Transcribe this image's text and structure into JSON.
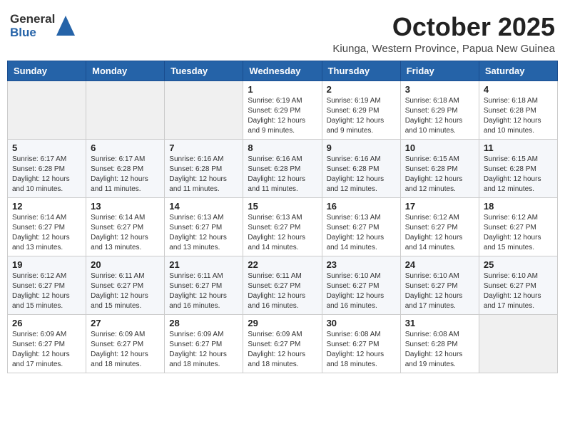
{
  "logo": {
    "general": "General",
    "blue": "Blue"
  },
  "header": {
    "month_title": "October 2025",
    "subtitle": "Kiunga, Western Province, Papua New Guinea"
  },
  "days_of_week": [
    "Sunday",
    "Monday",
    "Tuesday",
    "Wednesday",
    "Thursday",
    "Friday",
    "Saturday"
  ],
  "weeks": [
    [
      {
        "day": "",
        "sunrise": "",
        "sunset": "",
        "daylight": "",
        "empty": true
      },
      {
        "day": "",
        "sunrise": "",
        "sunset": "",
        "daylight": "",
        "empty": true
      },
      {
        "day": "",
        "sunrise": "",
        "sunset": "",
        "daylight": "",
        "empty": true
      },
      {
        "day": "1",
        "sunrise": "Sunrise: 6:19 AM",
        "sunset": "Sunset: 6:29 PM",
        "daylight": "Daylight: 12 hours and 9 minutes."
      },
      {
        "day": "2",
        "sunrise": "Sunrise: 6:19 AM",
        "sunset": "Sunset: 6:29 PM",
        "daylight": "Daylight: 12 hours and 9 minutes."
      },
      {
        "day": "3",
        "sunrise": "Sunrise: 6:18 AM",
        "sunset": "Sunset: 6:29 PM",
        "daylight": "Daylight: 12 hours and 10 minutes."
      },
      {
        "day": "4",
        "sunrise": "Sunrise: 6:18 AM",
        "sunset": "Sunset: 6:28 PM",
        "daylight": "Daylight: 12 hours and 10 minutes."
      }
    ],
    [
      {
        "day": "5",
        "sunrise": "Sunrise: 6:17 AM",
        "sunset": "Sunset: 6:28 PM",
        "daylight": "Daylight: 12 hours and 10 minutes."
      },
      {
        "day": "6",
        "sunrise": "Sunrise: 6:17 AM",
        "sunset": "Sunset: 6:28 PM",
        "daylight": "Daylight: 12 hours and 11 minutes."
      },
      {
        "day": "7",
        "sunrise": "Sunrise: 6:16 AM",
        "sunset": "Sunset: 6:28 PM",
        "daylight": "Daylight: 12 hours and 11 minutes."
      },
      {
        "day": "8",
        "sunrise": "Sunrise: 6:16 AM",
        "sunset": "Sunset: 6:28 PM",
        "daylight": "Daylight: 12 hours and 11 minutes."
      },
      {
        "day": "9",
        "sunrise": "Sunrise: 6:16 AM",
        "sunset": "Sunset: 6:28 PM",
        "daylight": "Daylight: 12 hours and 12 minutes."
      },
      {
        "day": "10",
        "sunrise": "Sunrise: 6:15 AM",
        "sunset": "Sunset: 6:28 PM",
        "daylight": "Daylight: 12 hours and 12 minutes."
      },
      {
        "day": "11",
        "sunrise": "Sunrise: 6:15 AM",
        "sunset": "Sunset: 6:28 PM",
        "daylight": "Daylight: 12 hours and 12 minutes."
      }
    ],
    [
      {
        "day": "12",
        "sunrise": "Sunrise: 6:14 AM",
        "sunset": "Sunset: 6:27 PM",
        "daylight": "Daylight: 12 hours and 13 minutes."
      },
      {
        "day": "13",
        "sunrise": "Sunrise: 6:14 AM",
        "sunset": "Sunset: 6:27 PM",
        "daylight": "Daylight: 12 hours and 13 minutes."
      },
      {
        "day": "14",
        "sunrise": "Sunrise: 6:13 AM",
        "sunset": "Sunset: 6:27 PM",
        "daylight": "Daylight: 12 hours and 13 minutes."
      },
      {
        "day": "15",
        "sunrise": "Sunrise: 6:13 AM",
        "sunset": "Sunset: 6:27 PM",
        "daylight": "Daylight: 12 hours and 14 minutes."
      },
      {
        "day": "16",
        "sunrise": "Sunrise: 6:13 AM",
        "sunset": "Sunset: 6:27 PM",
        "daylight": "Daylight: 12 hours and 14 minutes."
      },
      {
        "day": "17",
        "sunrise": "Sunrise: 6:12 AM",
        "sunset": "Sunset: 6:27 PM",
        "daylight": "Daylight: 12 hours and 14 minutes."
      },
      {
        "day": "18",
        "sunrise": "Sunrise: 6:12 AM",
        "sunset": "Sunset: 6:27 PM",
        "daylight": "Daylight: 12 hours and 15 minutes."
      }
    ],
    [
      {
        "day": "19",
        "sunrise": "Sunrise: 6:12 AM",
        "sunset": "Sunset: 6:27 PM",
        "daylight": "Daylight: 12 hours and 15 minutes."
      },
      {
        "day": "20",
        "sunrise": "Sunrise: 6:11 AM",
        "sunset": "Sunset: 6:27 PM",
        "daylight": "Daylight: 12 hours and 15 minutes."
      },
      {
        "day": "21",
        "sunrise": "Sunrise: 6:11 AM",
        "sunset": "Sunset: 6:27 PM",
        "daylight": "Daylight: 12 hours and 16 minutes."
      },
      {
        "day": "22",
        "sunrise": "Sunrise: 6:11 AM",
        "sunset": "Sunset: 6:27 PM",
        "daylight": "Daylight: 12 hours and 16 minutes."
      },
      {
        "day": "23",
        "sunrise": "Sunrise: 6:10 AM",
        "sunset": "Sunset: 6:27 PM",
        "daylight": "Daylight: 12 hours and 16 minutes."
      },
      {
        "day": "24",
        "sunrise": "Sunrise: 6:10 AM",
        "sunset": "Sunset: 6:27 PM",
        "daylight": "Daylight: 12 hours and 17 minutes."
      },
      {
        "day": "25",
        "sunrise": "Sunrise: 6:10 AM",
        "sunset": "Sunset: 6:27 PM",
        "daylight": "Daylight: 12 hours and 17 minutes."
      }
    ],
    [
      {
        "day": "26",
        "sunrise": "Sunrise: 6:09 AM",
        "sunset": "Sunset: 6:27 PM",
        "daylight": "Daylight: 12 hours and 17 minutes."
      },
      {
        "day": "27",
        "sunrise": "Sunrise: 6:09 AM",
        "sunset": "Sunset: 6:27 PM",
        "daylight": "Daylight: 12 hours and 18 minutes."
      },
      {
        "day": "28",
        "sunrise": "Sunrise: 6:09 AM",
        "sunset": "Sunset: 6:27 PM",
        "daylight": "Daylight: 12 hours and 18 minutes."
      },
      {
        "day": "29",
        "sunrise": "Sunrise: 6:09 AM",
        "sunset": "Sunset: 6:27 PM",
        "daylight": "Daylight: 12 hours and 18 minutes."
      },
      {
        "day": "30",
        "sunrise": "Sunrise: 6:08 AM",
        "sunset": "Sunset: 6:27 PM",
        "daylight": "Daylight: 12 hours and 18 minutes."
      },
      {
        "day": "31",
        "sunrise": "Sunrise: 6:08 AM",
        "sunset": "Sunset: 6:28 PM",
        "daylight": "Daylight: 12 hours and 19 minutes."
      },
      {
        "day": "",
        "sunrise": "",
        "sunset": "",
        "daylight": "",
        "empty": true
      }
    ]
  ]
}
